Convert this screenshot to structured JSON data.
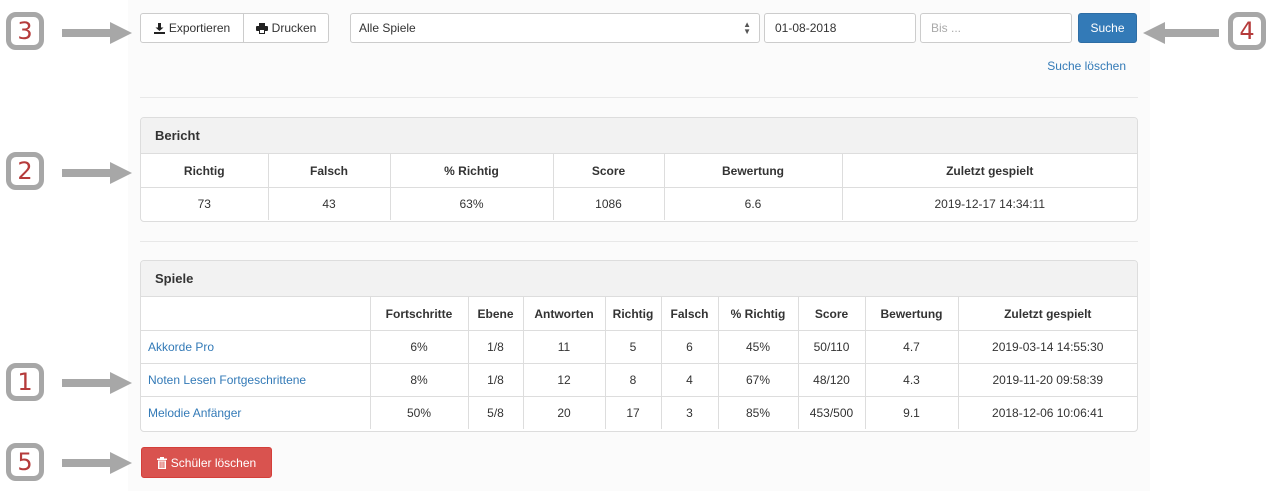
{
  "callouts": {
    "one": "1",
    "two": "2",
    "three": "3",
    "four": "4",
    "five": "5"
  },
  "toolbar": {
    "export_label": "Exportieren",
    "export_icon": "download-icon",
    "print_label": "Drucken",
    "print_icon": "printer-icon",
    "game_select_value": "Alle Spiele",
    "date_from_value": "01-08-2018",
    "date_to_placeholder": "Bis ...",
    "search_label": "Suche",
    "clear_search_label": "Suche löschen"
  },
  "report": {
    "title": "Bericht",
    "headers": [
      "Richtig",
      "Falsch",
      "% Richtig",
      "Score",
      "Bewertung",
      "Zuletzt gespielt"
    ],
    "row": [
      "73",
      "43",
      "63%",
      "1086",
      "6.6",
      "2019-12-17 14:34:11"
    ]
  },
  "games": {
    "title": "Spiele",
    "headers": [
      "",
      "Fortschritte",
      "Ebene",
      "Antworten",
      "Richtig",
      "Falsch",
      "% Richtig",
      "Score",
      "Bewertung",
      "Zuletzt gespielt"
    ],
    "rows": [
      [
        "Akkorde Pro",
        "6%",
        "1/8",
        "11",
        "5",
        "6",
        "45%",
        "50/110",
        "4.7",
        "2019-03-14 14:55:30"
      ],
      [
        "Noten Lesen Fortgeschrittene",
        "8%",
        "1/8",
        "12",
        "8",
        "4",
        "67%",
        "48/120",
        "4.3",
        "2019-11-20 09:58:39"
      ],
      [
        "Melodie Anfänger",
        "50%",
        "5/8",
        "20",
        "17",
        "3",
        "85%",
        "453/500",
        "9.1",
        "2018-12-06 10:06:41"
      ]
    ]
  },
  "delete_student_label": "Schüler löschen",
  "delete_icon": "trash-icon",
  "colors": {
    "primary": "#337ab7",
    "danger": "#d9534f",
    "callout_border": "#a7a7a7",
    "callout_text": "#b53b3b"
  }
}
